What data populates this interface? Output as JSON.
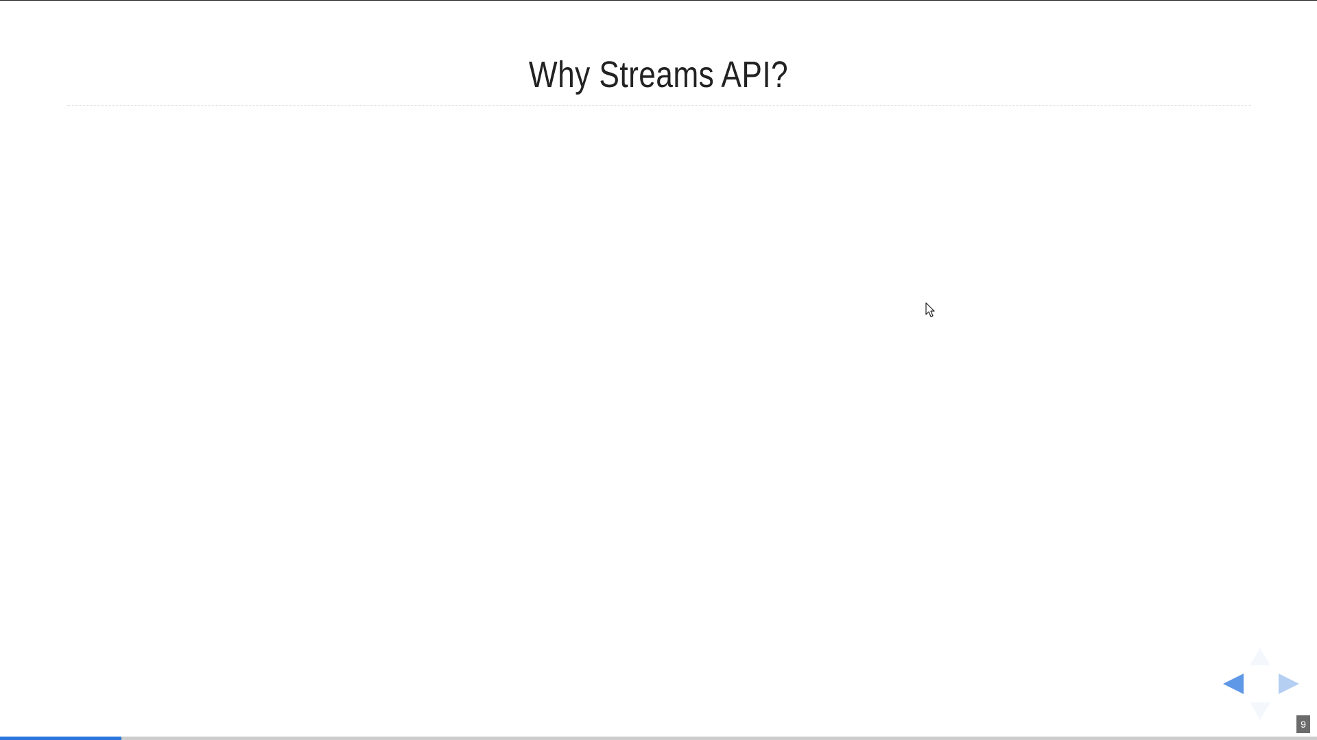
{
  "slide": {
    "title": "Why Streams API?",
    "number": "9"
  },
  "progress": {
    "fraction": 0.092,
    "color": "#2a76dd",
    "track_color": "#cccccc"
  },
  "controls": {
    "left_icon": "arrow-left-icon",
    "right_icon": "arrow-right-icon",
    "up_icon": "arrow-up-icon",
    "down_icon": "arrow-down-icon",
    "accent": "#2a76dd"
  }
}
